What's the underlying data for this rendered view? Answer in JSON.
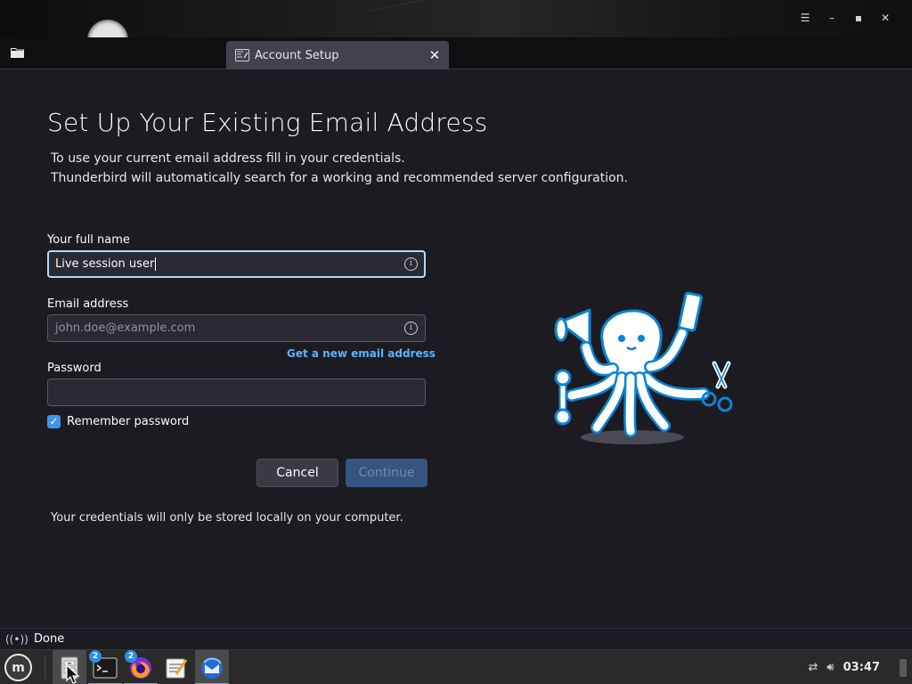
{
  "window": {
    "controls": {
      "menu": "☰",
      "minimize": "–",
      "maximize": "▪",
      "close": "✕"
    }
  },
  "tabs": [
    {
      "label": "Account Setup",
      "icon": "account-setup-icon",
      "close": "✕"
    }
  ],
  "page": {
    "heading": "Set Up Your Existing Email Address",
    "desc_line1": "To use your current email address fill in your credentials.",
    "desc_line2": "Thunderbird will automatically search for a working and recommended server configuration."
  },
  "form": {
    "full_name": {
      "label": "Your full name",
      "value": "Live session user"
    },
    "email": {
      "label": "Email address",
      "placeholder": "john.doe@example.com",
      "value": ""
    },
    "new_email_link": "Get a new email address",
    "password": {
      "label": "Password",
      "value": ""
    },
    "remember": {
      "label": "Remember password",
      "checked": true,
      "mark": "✓"
    },
    "cancel_label": "Cancel",
    "continue_label": "Continue",
    "footnote": "Your credentials will only be stored locally on your computer."
  },
  "status": {
    "text": "Done",
    "icon": "signal-icon"
  },
  "taskbar": {
    "menu_glyph": "m",
    "apps": [
      {
        "name": "files",
        "badge": ""
      },
      {
        "name": "terminal",
        "badge": "2"
      },
      {
        "name": "firefox",
        "badge": "2"
      },
      {
        "name": "text-editor",
        "badge": ""
      },
      {
        "name": "thunderbird",
        "badge": ""
      }
    ],
    "clock": "03:47"
  },
  "colors": {
    "accent": "#3d96e8",
    "link": "#5ab3ff",
    "background": "#1c1b22",
    "focus_ring": "#b4d8fe"
  }
}
